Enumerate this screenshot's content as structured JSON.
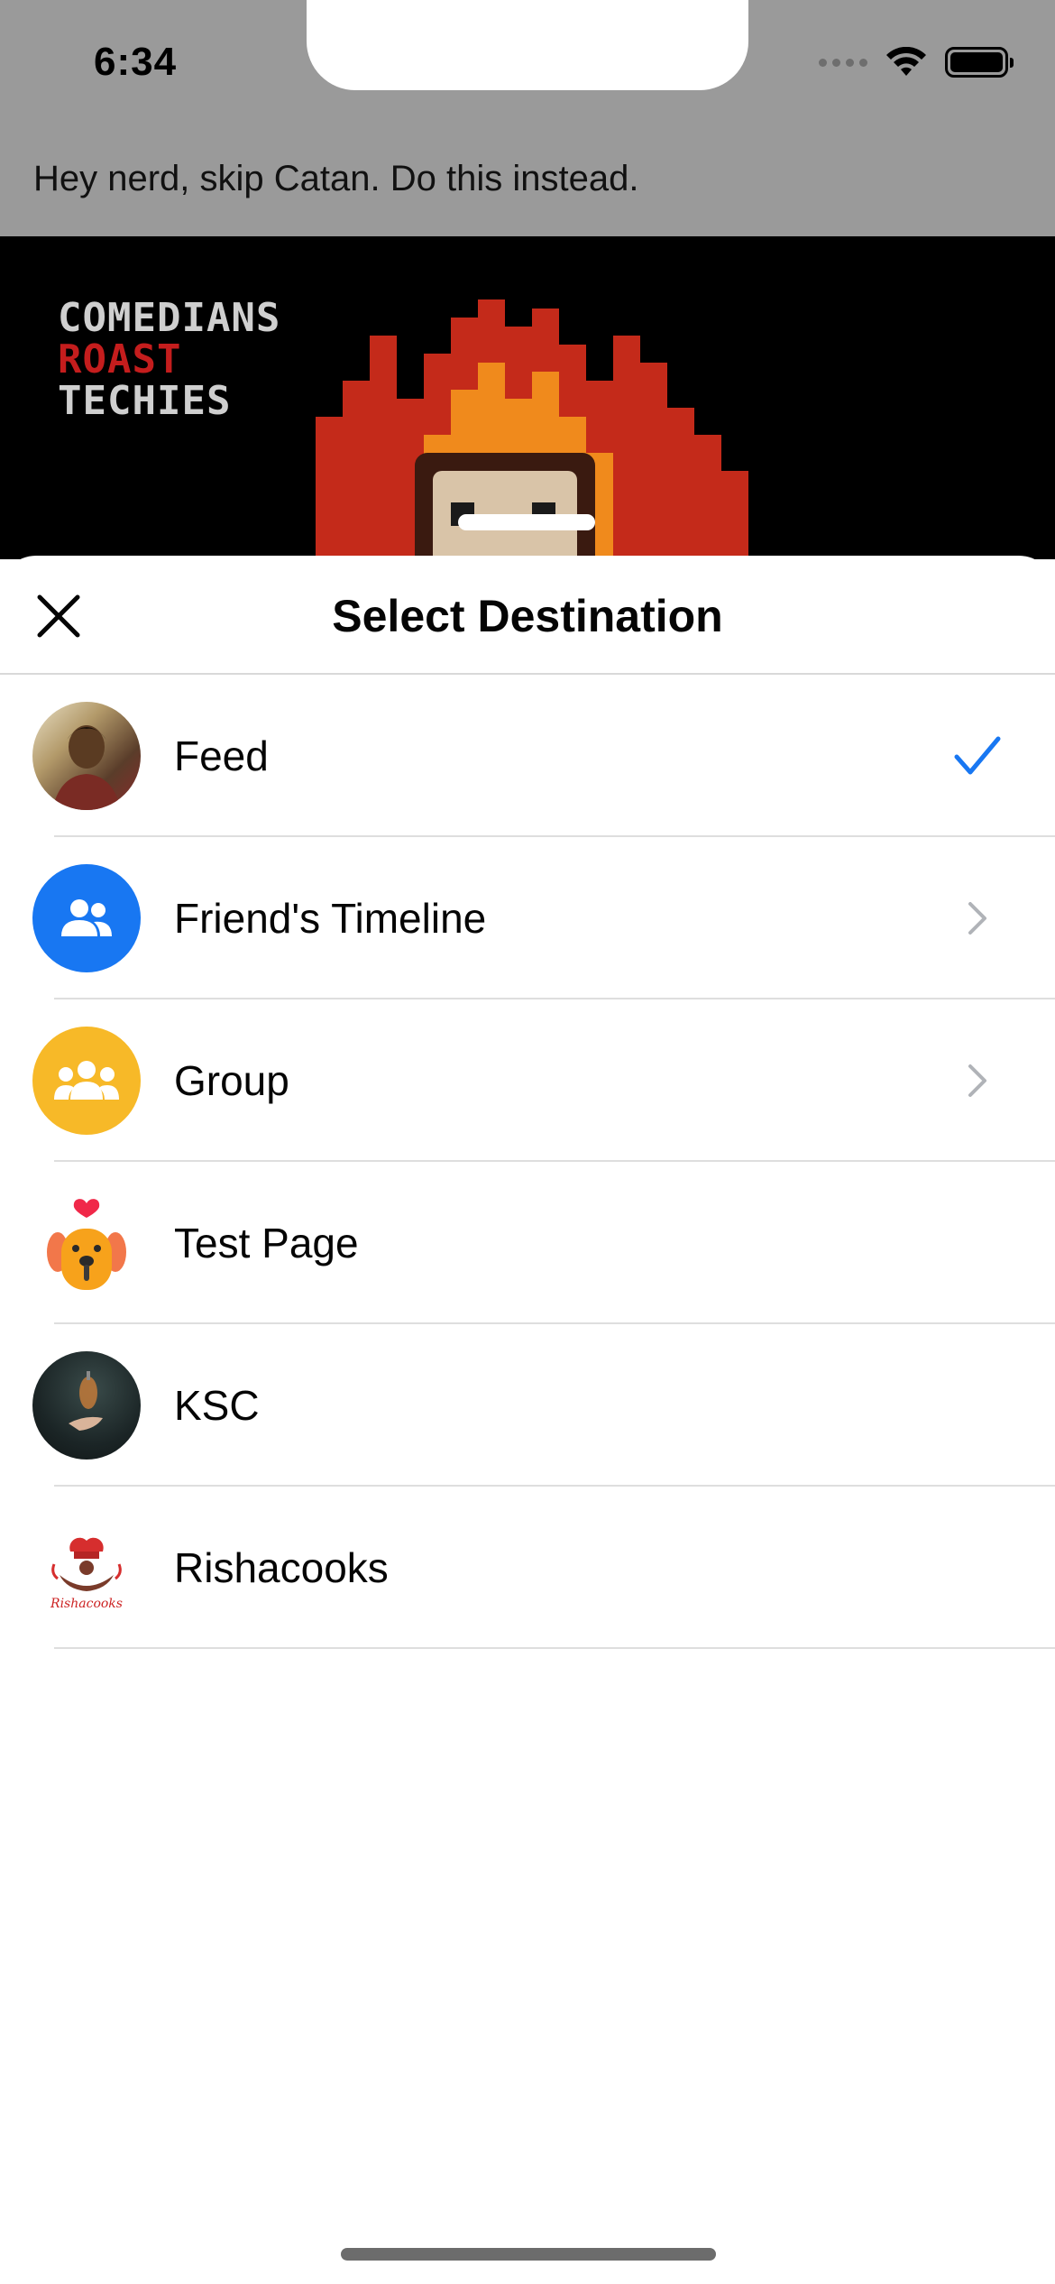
{
  "status_bar": {
    "time": "6:34"
  },
  "background_post": {
    "caption": "Hey nerd, skip Catan. Do this instead.",
    "image_text": [
      "COMEDIANS",
      "ROAST",
      "TECHIES"
    ]
  },
  "sheet": {
    "title": "Select Destination",
    "close_icon": "close-icon"
  },
  "destinations": [
    {
      "label": "Feed",
      "icon": "profile-photo",
      "trailing": "checkmark-icon",
      "selected": true
    },
    {
      "label": "Friend's Timeline",
      "icon": "friends-icon",
      "trailing": "chevron-right-icon"
    },
    {
      "label": "Group",
      "icon": "group-icon",
      "trailing": "chevron-right-icon"
    },
    {
      "label": "Test Page",
      "icon": "dog-page-icon",
      "trailing": ""
    },
    {
      "label": "KSC",
      "icon": "page-photo",
      "trailing": ""
    },
    {
      "label": "Rishacooks",
      "icon": "rishacooks-logo",
      "trailing": ""
    }
  ],
  "colors": {
    "accent_blue": "#1877f2",
    "group_yellow": "#f7b928",
    "chevron_gray": "#b0b3b8",
    "text": "#050505"
  }
}
